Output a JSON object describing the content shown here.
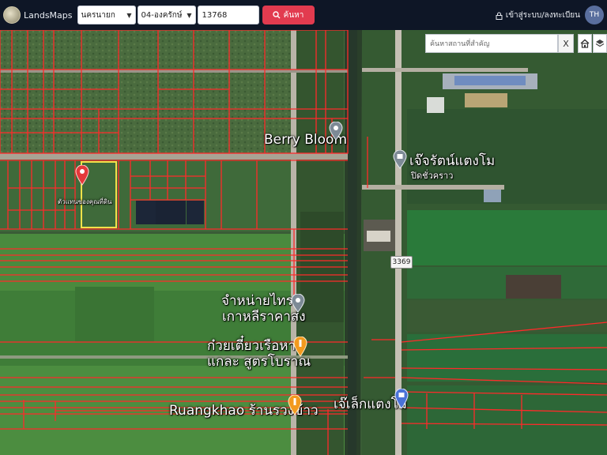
{
  "topbar": {
    "brand": "LandsMaps",
    "province": "นครนายก",
    "district": "04-องครักษ์",
    "parcel_number": "13768",
    "search_label": "ค้นหา",
    "login_label": "เข้าสู่ระบบ/ลงทะเบียน",
    "avatar_initials": "TH"
  },
  "map_controls": {
    "place_search_placeholder": "ค้นหาสถานที่สำคัญ",
    "clear_label": "X"
  },
  "places": {
    "berry_bloom": "Berry Bloom",
    "jaroen_line1": "เจ๊จรัตน์แตงโม",
    "jaroen_line2": "ปิดชั่วคราว",
    "tiles_line1": "จำหน่ายไทร",
    "tiles_line2": "เกาหลีราคาส่ง",
    "noodle_line1": "ก๋วยเตี๋ยวเรือหาย",
    "noodle_line2": "แกละ สูตรโบราณ",
    "ruangkhao": "Ruangkhao ร้านรวงข้าว",
    "jeklek": "เจ๊เล็กแตงโม",
    "selected_parcel": "ตัวแทนของคุณที่ดิน",
    "route": "3369"
  },
  "colors": {
    "parcel_lines": "#ff2a2a",
    "selected_parcel": "#f2e14a",
    "search_button": "#e23b4f",
    "topbar": "#0e1626"
  }
}
